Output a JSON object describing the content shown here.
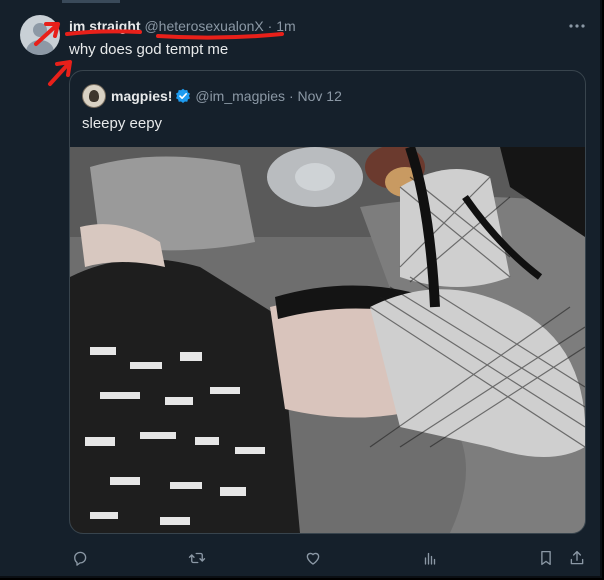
{
  "tweet": {
    "display_name": "im straight",
    "handle": "@heterosexualonX",
    "separator": "·",
    "time": "1m",
    "text": "why does god tempt me",
    "more_icon": "more-horizontal-icon"
  },
  "quoted_tweet": {
    "display_name": "magpies!",
    "verified": true,
    "handle": "@im_magpies",
    "separator": "·",
    "date": "Nov 12",
    "text": "sleepy eepy"
  },
  "actions": [
    {
      "icon": "reply-icon"
    },
    {
      "icon": "retweet-icon"
    },
    {
      "icon": "like-icon"
    },
    {
      "icon": "views-icon"
    },
    {
      "icon": "bookmark-icon"
    },
    {
      "icon": "share-icon"
    }
  ],
  "colors": {
    "background": "#15202b",
    "text_primary": "#e7e9ea",
    "text_secondary": "#8b98a5",
    "border": "#38444d",
    "verified_blue": "#1d9bf0",
    "annotation_red": "#e8201a"
  }
}
